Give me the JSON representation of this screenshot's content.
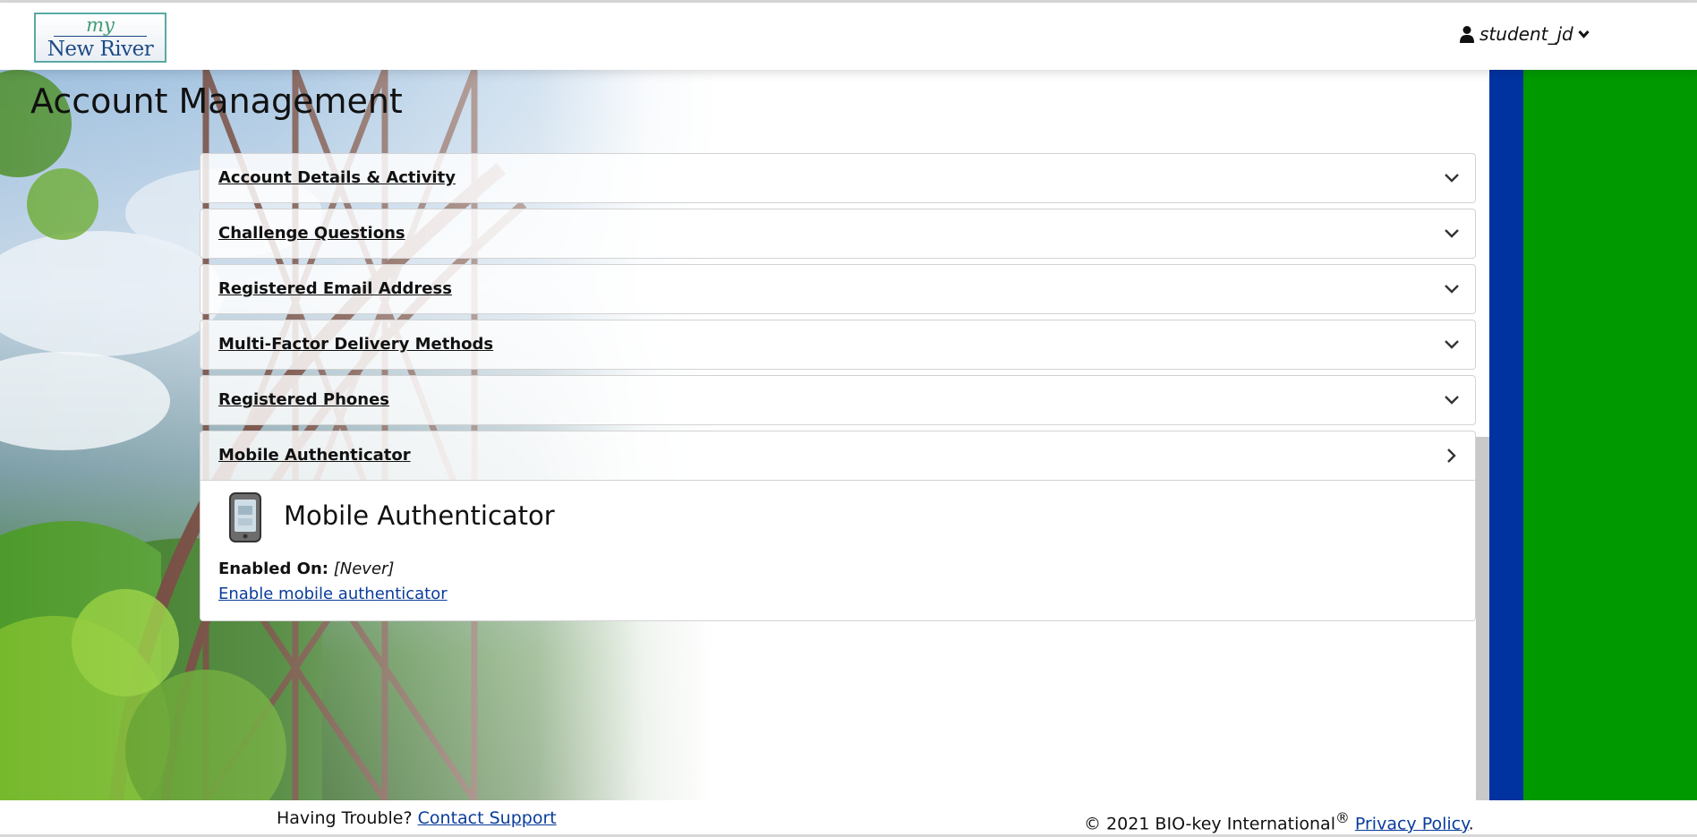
{
  "header": {
    "logo": {
      "line1": "my",
      "line2": "New River"
    },
    "user": {
      "name": "student_jd",
      "icon": "user-icon",
      "dropdown_icon": "chevron-down-icon"
    }
  },
  "main": {
    "title": "Account Management",
    "sections": [
      {
        "label": "Account Details & Activity",
        "expanded": false
      },
      {
        "label": "Challenge Questions",
        "expanded": false
      },
      {
        "label": "Registered Email Address",
        "expanded": false
      },
      {
        "label": "Multi-Factor Delivery Methods",
        "expanded": false
      },
      {
        "label": "Registered Phones",
        "expanded": false
      },
      {
        "label": "Mobile Authenticator",
        "expanded": true
      }
    ],
    "mobile_authenticator": {
      "icon": "mobile-phone-icon",
      "heading": "Mobile Authenticator",
      "enabled_label": "Enabled On:",
      "enabled_value": "[Never]",
      "enable_link": "Enable mobile authenticator"
    }
  },
  "footer": {
    "trouble_text": "Having Trouble?",
    "support_link": "Contact Support",
    "copyright": "© 2021 BIO-key International",
    "registered_mark": "®",
    "privacy_link": "Privacy Policy",
    "period": "."
  },
  "colors": {
    "stripe_blue": "#0033a0",
    "stripe_green": "#009a00",
    "link": "#0a3c9b",
    "logo_teal": "#5aa9a3",
    "logo_navy": "#1c4b86"
  }
}
